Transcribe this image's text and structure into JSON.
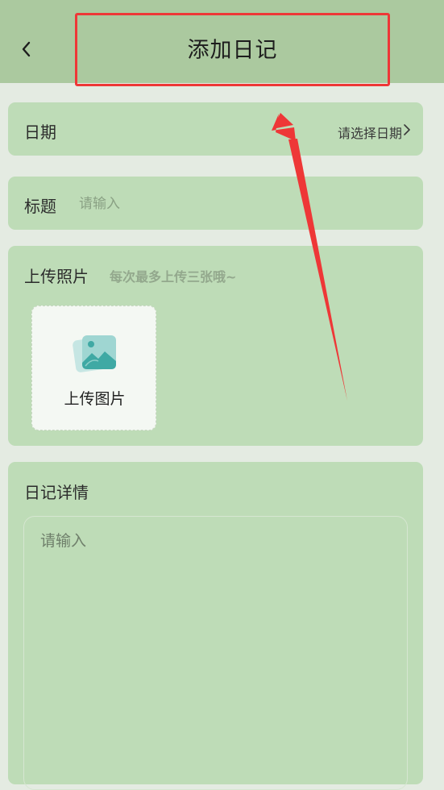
{
  "header": {
    "back_icon": "chevron-left-icon",
    "title": "添加日记"
  },
  "date": {
    "label": "日期",
    "value": "请选择日期",
    "chevron_icon": "chevron-right-icon"
  },
  "entry_title": {
    "label": "标题",
    "placeholder": "请输入"
  },
  "photos": {
    "label": "上传照片",
    "hint": "每次最多上传三张哦~",
    "upload_label": "上传图片",
    "upload_icon": "image-icon"
  },
  "details": {
    "label": "日记详情",
    "placeholder": "请输入"
  },
  "annotation": {
    "highlight_color": "#ee3737"
  },
  "colors": {
    "header_bg": "#abc99f",
    "card_bg": "#bedcb7",
    "page_bg": "#e4ebe2"
  }
}
